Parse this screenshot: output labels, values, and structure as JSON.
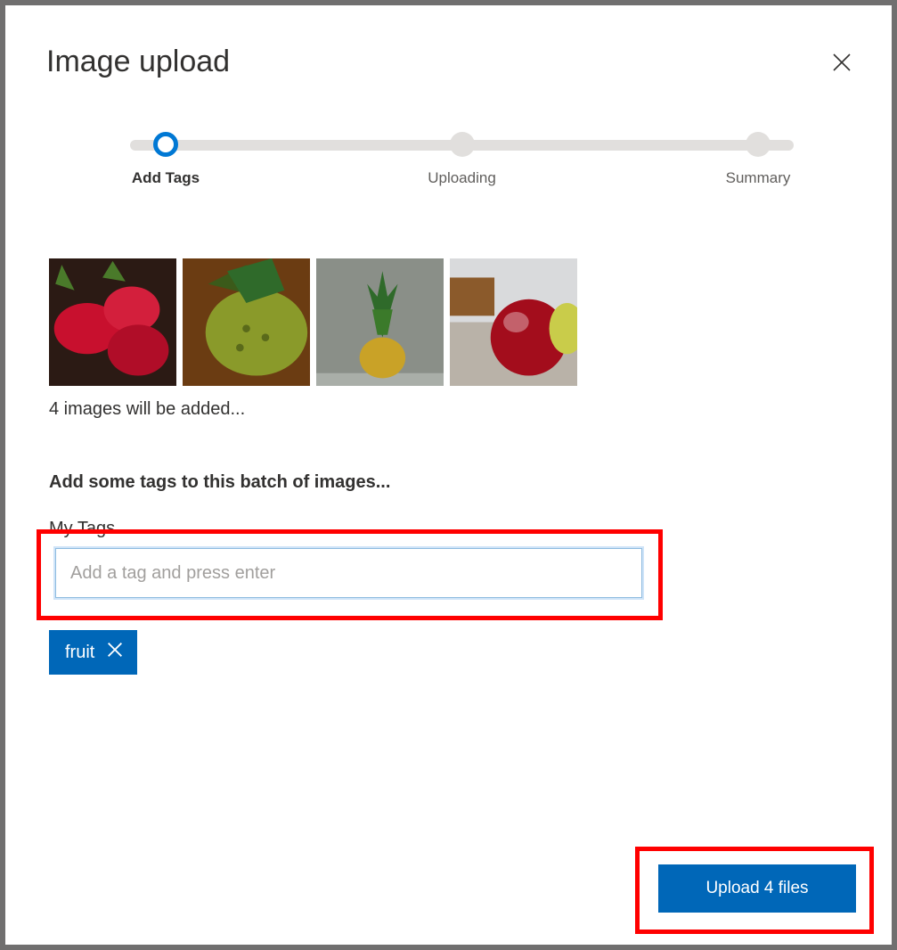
{
  "dialog": {
    "title": "Image upload"
  },
  "stepper": {
    "steps": [
      {
        "label": "Add Tags",
        "active": true
      },
      {
        "label": "Uploading",
        "active": false
      },
      {
        "label": "Summary",
        "active": false
      }
    ]
  },
  "thumbnails": {
    "count_text": "4 images will be added..."
  },
  "tags_section": {
    "instruction": "Add some tags to this batch of images...",
    "label": "My Tags",
    "input_placeholder": "Add a tag and press enter",
    "input_value": ""
  },
  "tags": [
    {
      "name": "fruit"
    }
  ],
  "upload_button": {
    "label": "Upload 4 files"
  }
}
